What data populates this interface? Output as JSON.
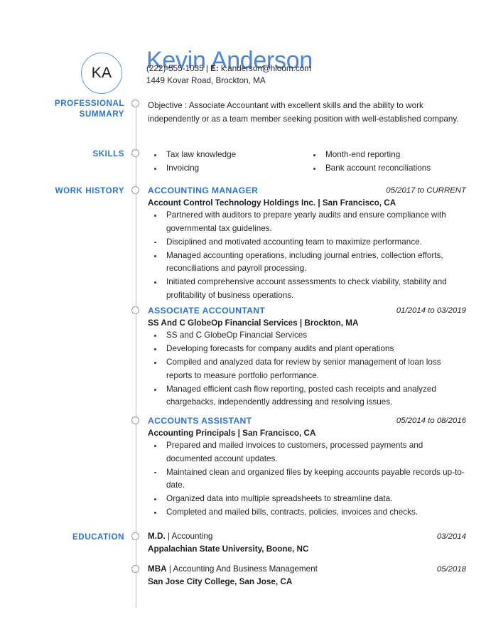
{
  "theme": {
    "accent_blue": "#2e75c8",
    "name_blue": "#4a86d4",
    "avatar_ring": "#5b9bd5",
    "timeline_gray": "#b8b8b8",
    "text": "#262626"
  },
  "header": {
    "avatar_initials": "KA",
    "name": "Kevin Anderson",
    "contact_line_1_phone": "(222)-555-1035",
    "contact_line_1_separator": " | ",
    "contact_line_1_email_label": "E:",
    "contact_line_1_email": " k.anderson@hloom.com",
    "contact_line_2_address": "1449 Kovar Road, Brockton, MA"
  },
  "sections": {
    "professional_summary": {
      "label_line_1": "PROFESSIONAL",
      "label_line_2": "SUMMARY",
      "text": "Objective : Associate Accountant with excellent skills and the ability to work independently or as a team member seeking position with well-established company."
    },
    "skills": {
      "label": "SKILLS",
      "column_left": [
        "Tax law knowledge",
        "Invoicing"
      ],
      "column_right": [
        "Month-end reporting",
        "Bank account reconciliations"
      ]
    },
    "work_history": {
      "label": "WORK HISTORY",
      "jobs": [
        {
          "title": "ACCOUNTING MANAGER",
          "date": "05/2017 to CURRENT",
          "company": "Account Control Technology Holdings Inc. | San Francisco, CA",
          "bullets": [
            "Partnered with auditors to prepare yearly audits and ensure compliance with governmental tax guidelines.",
            "Disciplined and motivated accounting team to maximize performance.",
            "Managed accounting operations, including journal entries, collection efforts, reconciliations and payroll processing.",
            "Initiated comprehensive account assessments to check viability, stability and profitability of business operations."
          ]
        },
        {
          "title": "ASSOCIATE ACCOUNTANT",
          "date": "01/2014 to 03/2019",
          "company": "SS And C GlobeOp Financial Services | Brockton, MA",
          "bullets": [
            "SS and C GlobeOp Financial Services",
            "Developing forecasts for company audits and plant operations",
            "Compiled and analyzed data for review by senior management of loan loss reports to measure portfolio performance.",
            "Managed efficient cash flow reporting, posted cash receipts and analyzed chargebacks, independently addressing and resolving issues."
          ]
        },
        {
          "title": "ACCOUNTS ASSISTANT",
          "date": "05/2014 to 08/2016",
          "company": "Accounting Principals | San Francisco, CA",
          "bullets": [
            "Prepared and mailed invoices to customers, processed payments and documented account updates.",
            "Maintained clean and organized files by keeping accounts payable records up-to-date.",
            "Organized data into multiple spreadsheets to streamline data.",
            "Completed and mailed bills, contracts, policies, invoices and checks."
          ]
        }
      ]
    },
    "education": {
      "label": "EDUCATION",
      "entries": [
        {
          "degree_abbr": "M.D.",
          "degree_rest": " | Accounting",
          "date": "03/2014",
          "school": "Appalachian State University, Boone, NC"
        },
        {
          "degree_abbr": "MBA",
          "degree_rest": " | Accounting And Business Management",
          "date": "05/2018",
          "school": "San Jose City College, San Jose, CA"
        }
      ]
    }
  }
}
